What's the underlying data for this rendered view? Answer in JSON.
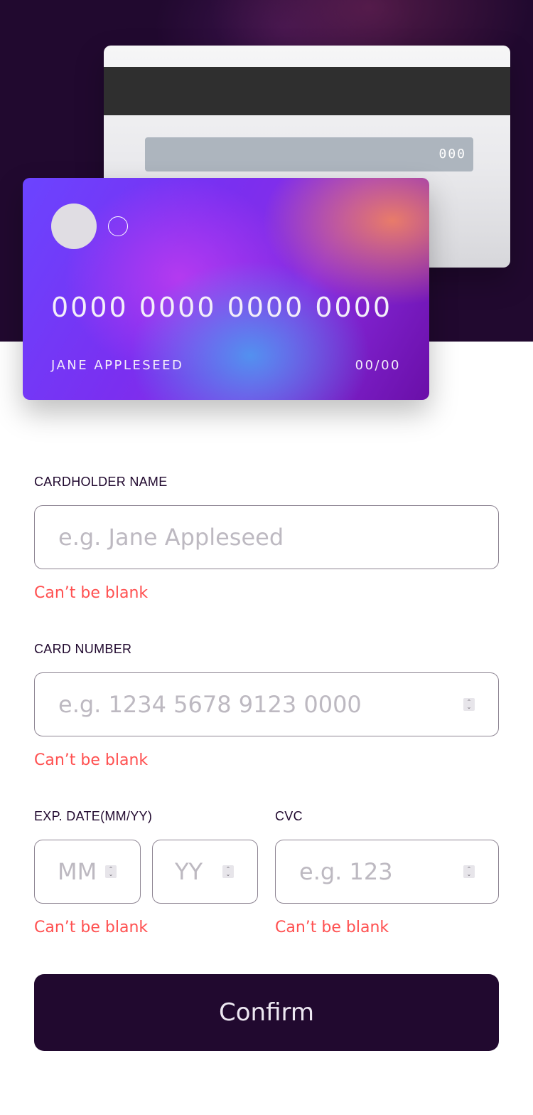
{
  "card": {
    "back": {
      "cvc": "000"
    },
    "front": {
      "number": "0000 0000 0000 0000",
      "name": "JANE APPLESEED",
      "expiry": "00/00"
    }
  },
  "form": {
    "cardholder": {
      "label": "CARDHOLDER NAME",
      "placeholder": "e.g. Jane Appleseed",
      "error": "Can’t be blank"
    },
    "number": {
      "label": "CARD NUMBER",
      "placeholder": "e.g. 1234 5678 9123 0000",
      "error": "Can’t be blank"
    },
    "expiry": {
      "label": "EXP. DATE(MM/YY)",
      "month_placeholder": "MM",
      "year_placeholder": "YY",
      "error": "Can’t be blank"
    },
    "cvc": {
      "label": "CVC",
      "placeholder": "e.g. 123",
      "error": "Can’t be blank"
    },
    "confirm_label": "Confirm"
  },
  "colors": {
    "dark": "#21092f",
    "error": "#ff5050",
    "placeholder": "#bdb9c1",
    "border": "#8e8593"
  }
}
